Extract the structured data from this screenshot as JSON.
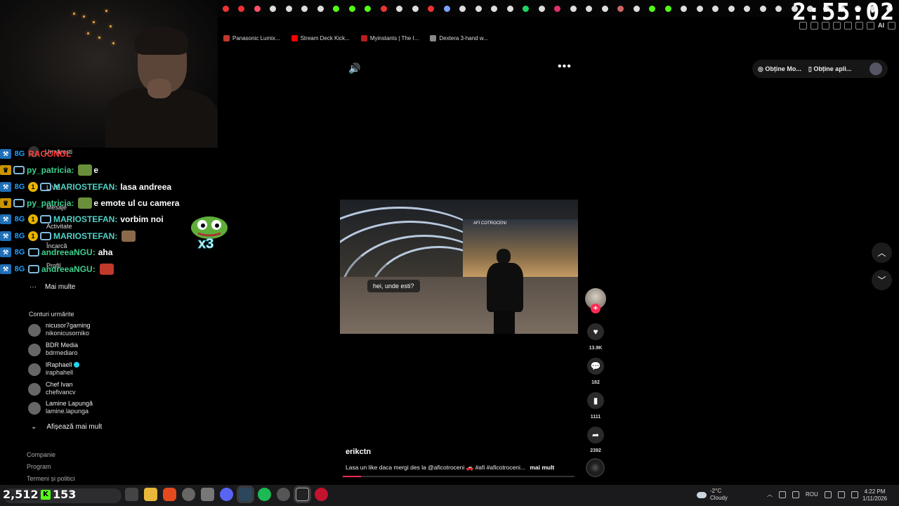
{
  "clock": "2:55:02",
  "toolbar": {
    "ai_label": "AI"
  },
  "bookmarks": [
    {
      "label": "Panasonic Lumix...",
      "color": "#c0392b"
    },
    {
      "label": "Stream Deck Kick...",
      "color": "#ff0000"
    },
    {
      "label": "Myinstants | The I...",
      "color": "#b91c1c"
    },
    {
      "label": "Dextera 3-hand w...",
      "color": "#888888"
    }
  ],
  "tiktok": {
    "nav": {
      "following": "Urmărești",
      "live": "LIVE",
      "messages": "Mesaje",
      "activity": "Activitate",
      "upload": "Încarcă",
      "profile": "Profil",
      "more": "Mai multe"
    },
    "following_title": "Conturi urmărite",
    "accounts": [
      {
        "name": "nicusor7gaming",
        "handle": "nikonicusorniko"
      },
      {
        "name": "BDR Media",
        "handle": "bdrmediaro"
      },
      {
        "name": "lRaphaell",
        "handle": "iraphahell",
        "verified": true
      },
      {
        "name": "Chef Ivan",
        "handle": "chefivancv"
      },
      {
        "name": "Lamine Lapungă",
        "handle": "lamine.lapunga"
      }
    ],
    "show_more": "Afișează mai mult",
    "footer": [
      "Companie",
      "Program",
      "Termeni și politici"
    ],
    "get_pill": {
      "mode": "Obține Mo...",
      "app": "Obține apli..."
    },
    "video": {
      "caption_bubble": "hei, unde esti?",
      "mall_sign": "AFI COTROCENI",
      "author": "erikctn",
      "description": "Lasa un like daca mergi des la @aficotroceni 🚗 #afi #aficotroceni...",
      "more_link": "mai mult",
      "progress": 0.08
    },
    "actions": {
      "likes": "13.9K",
      "comments": "182",
      "saves": "1111",
      "shares": "2392"
    }
  },
  "chat": [
    {
      "badges": [
        "mod",
        "8g"
      ],
      "name": "RAGONOL",
      "name_color": "#ff3d3d",
      "message": ""
    },
    {
      "badges": [
        "crown",
        "cam"
      ],
      "name": "py_patricia:",
      "name_color": "#3ecf8e",
      "message": "e"
    },
    {
      "badges": [
        "mod",
        "8g",
        "gold",
        "cam"
      ],
      "name": "MARIOSTEFAN:",
      "name_color": "#4fd1c5",
      "message": "lasa andreea"
    },
    {
      "badges": [
        "crown",
        "cam"
      ],
      "name": "py_patricia:",
      "name_color": "#3ecf8e",
      "message": "e emote ul cu camera"
    },
    {
      "badges": [
        "mod",
        "8g",
        "gold",
        "cam"
      ],
      "name": "MARIOSTEFAN:",
      "name_color": "#4fd1c5",
      "message": "vorbim noi"
    },
    {
      "badges": [
        "mod",
        "8g",
        "gold",
        "cam"
      ],
      "name": "MARIOSTEFAN:",
      "name_color": "#4fd1c5",
      "message": ""
    },
    {
      "badges": [
        "mod",
        "8g",
        "cam"
      ],
      "name": "andreeaNGU:",
      "name_color": "#3ecf8e",
      "message": "aha"
    },
    {
      "badges": [
        "mod",
        "8g",
        "cam"
      ],
      "name": "andreeaNGU:",
      "name_color": "#3ecf8e",
      "message": ""
    }
  ],
  "pepe_multiplier": "x3",
  "stream": {
    "viewers": "2,512",
    "kick_count": "153"
  },
  "taskbar": {
    "weather_temp": "-2°C",
    "weather_desc": "Cloudy",
    "language": "ROU",
    "time": "4:22 PM",
    "date": "1/11/2026"
  }
}
